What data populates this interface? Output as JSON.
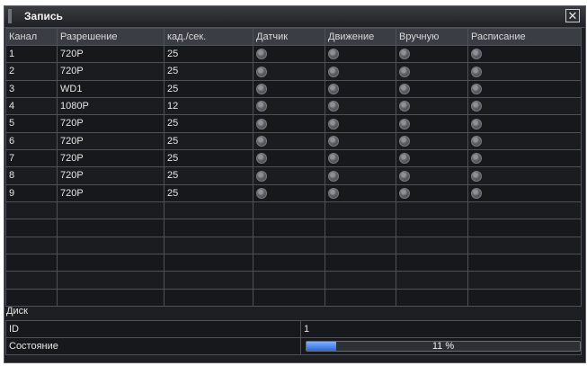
{
  "window": {
    "title": "Запись",
    "close_glyph": "✕"
  },
  "table": {
    "headers": [
      "Канал",
      "Разрешение",
      "кад./сек.",
      "Датчик",
      "Движение",
      "Вручную",
      "Расписание"
    ],
    "rows": [
      {
        "channel": "1",
        "resolution": "720P",
        "fps": "25"
      },
      {
        "channel": "2",
        "resolution": "720P",
        "fps": "25"
      },
      {
        "channel": "3",
        "resolution": "WD1",
        "fps": "25"
      },
      {
        "channel": "4",
        "resolution": "1080P",
        "fps": "12"
      },
      {
        "channel": "5",
        "resolution": "720P",
        "fps": "25"
      },
      {
        "channel": "6",
        "resolution": "720P",
        "fps": "25"
      },
      {
        "channel": "7",
        "resolution": "720P",
        "fps": "25"
      },
      {
        "channel": "8",
        "resolution": "720P",
        "fps": "25"
      },
      {
        "channel": "9",
        "resolution": "720P",
        "fps": "25"
      }
    ]
  },
  "disk": {
    "title": "Диск",
    "id_label": "ID",
    "id_value": "1",
    "status_label": "Состояние",
    "usage_text": "11 %",
    "usage_fraction": 0.11
  },
  "colors": {
    "progress_fill": "#2d67d8"
  }
}
